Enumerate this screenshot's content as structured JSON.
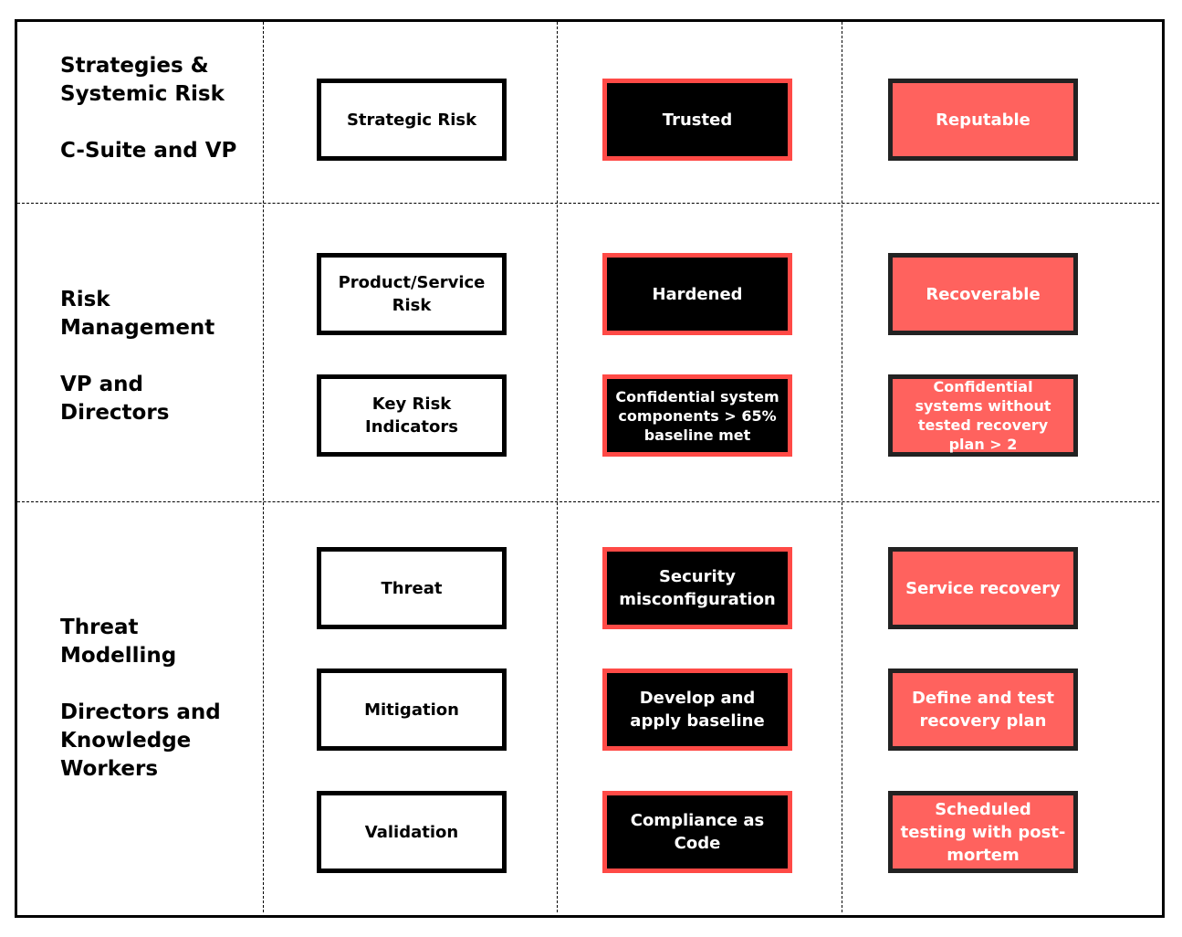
{
  "colors": {
    "black_box_border": "#ff4a46",
    "salmon_fill": "#ff625e",
    "salmon_border": "#222222"
  },
  "rows": [
    {
      "title": "Strategies & Systemic Risk",
      "audience": "C-Suite and VP",
      "items": [
        {
          "risk": "Strategic Risk",
          "security": "Trusted",
          "resilience": "Reputable"
        }
      ]
    },
    {
      "title": "Risk Management",
      "audience": "VP and Directors",
      "items": [
        {
          "risk": "Product/Service Risk",
          "security": "Hardened",
          "resilience": "Recoverable"
        },
        {
          "risk": "Key Risk Indicators",
          "security": "Confidential system components > 65% baseline met",
          "resilience": "Confidential systems without tested recovery plan > 2"
        }
      ]
    },
    {
      "title": "Threat Modelling",
      "audience": "Directors and Knowledge Workers",
      "items": [
        {
          "risk": "Threat",
          "security": "Security misconfiguration",
          "resilience": "Service recovery"
        },
        {
          "risk": "Mitigation",
          "security": "Develop and apply baseline",
          "resilience": "Define and test recovery plan"
        },
        {
          "risk": "Validation",
          "security": "Compliance as Code",
          "resilience": "Scheduled testing with post-mortem"
        }
      ]
    }
  ]
}
